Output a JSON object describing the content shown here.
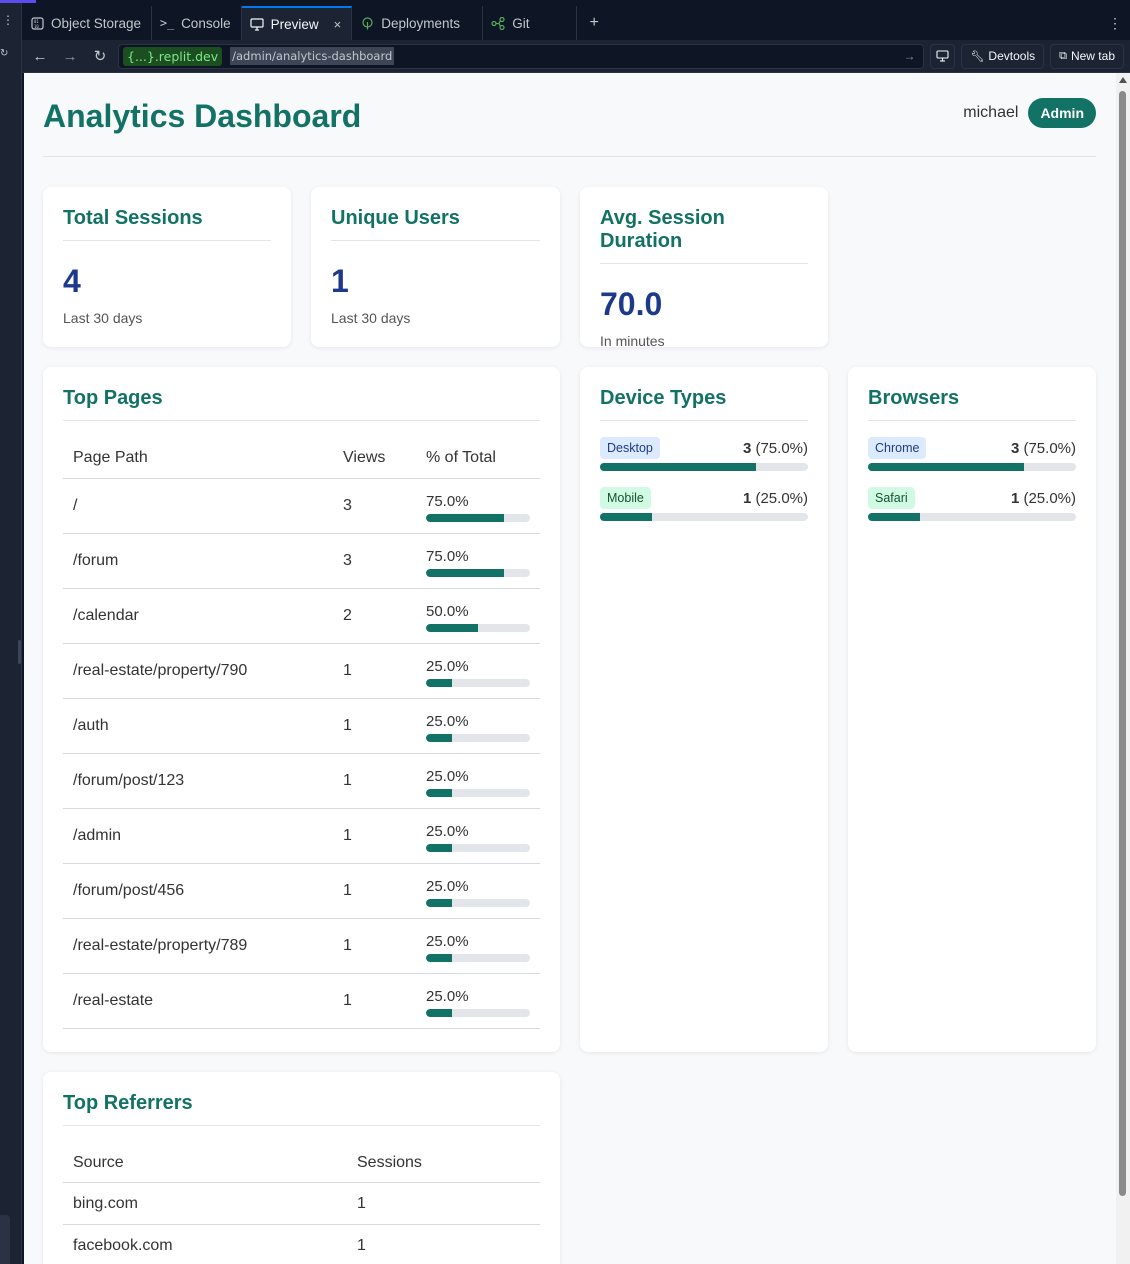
{
  "ide": {
    "tabs": [
      {
        "label": "Object Storage",
        "icon": "storage-icon"
      },
      {
        "label": "Console",
        "icon": "terminal-icon"
      },
      {
        "label": "Preview",
        "icon": "monitor-icon",
        "active": true
      },
      {
        "label": "Deployments",
        "icon": "deploy-icon"
      },
      {
        "label": "Git",
        "icon": "git-icon"
      }
    ],
    "tab_close": "×",
    "tab_add": "+",
    "url": {
      "domain": "{...}.replit.dev",
      "path": "/admin/analytics-dashboard"
    },
    "devtools_label": "Devtools",
    "newtab_label": "New tab"
  },
  "header": {
    "title": "Analytics Dashboard",
    "user": "michael",
    "role": "Admin"
  },
  "stats": [
    {
      "title": "Total Sessions",
      "value": "4",
      "sub": "Last 30 days"
    },
    {
      "title": "Unique Users",
      "value": "1",
      "sub": "Last 30 days"
    },
    {
      "title": "Avg. Session Duration",
      "value": "70.0",
      "sub": "In minutes"
    }
  ],
  "top_pages": {
    "title": "Top Pages",
    "columns": [
      "Page Path",
      "Views",
      "% of Total"
    ],
    "rows": [
      {
        "path": "/",
        "views": "3",
        "pct": "75.0%",
        "fraction": 0.75
      },
      {
        "path": "/forum",
        "views": "3",
        "pct": "75.0%",
        "fraction": 0.75
      },
      {
        "path": "/calendar",
        "views": "2",
        "pct": "50.0%",
        "fraction": 0.5
      },
      {
        "path": "/real-estate/property/790",
        "views": "1",
        "pct": "25.0%",
        "fraction": 0.25
      },
      {
        "path": "/auth",
        "views": "1",
        "pct": "25.0%",
        "fraction": 0.25
      },
      {
        "path": "/forum/post/123",
        "views": "1",
        "pct": "25.0%",
        "fraction": 0.25
      },
      {
        "path": "/admin",
        "views": "1",
        "pct": "25.0%",
        "fraction": 0.25
      },
      {
        "path": "/forum/post/456",
        "views": "1",
        "pct": "25.0%",
        "fraction": 0.25
      },
      {
        "path": "/real-estate/property/789",
        "views": "1",
        "pct": "25.0%",
        "fraction": 0.25
      },
      {
        "path": "/real-estate",
        "views": "1",
        "pct": "25.0%",
        "fraction": 0.25
      }
    ]
  },
  "device_types": {
    "title": "Device Types",
    "items": [
      {
        "label": "Desktop",
        "count": "3",
        "pct": "(75.0%)",
        "fraction": 0.75,
        "chip": "blue"
      },
      {
        "label": "Mobile",
        "count": "1",
        "pct": "(25.0%)",
        "fraction": 0.25,
        "chip": "green"
      }
    ]
  },
  "browsers": {
    "title": "Browsers",
    "items": [
      {
        "label": "Chrome",
        "count": "3",
        "pct": "(75.0%)",
        "fraction": 0.75,
        "chip": "blue"
      },
      {
        "label": "Safari",
        "count": "1",
        "pct": "(25.0%)",
        "fraction": 0.25,
        "chip": "green"
      }
    ]
  },
  "top_referrers": {
    "title": "Top Referrers",
    "columns": [
      "Source",
      "Sessions"
    ],
    "rows": [
      {
        "source": "bing.com",
        "sessions": "1"
      },
      {
        "source": "facebook.com",
        "sessions": "1"
      }
    ]
  },
  "colors": {
    "accent": "#127266",
    "stat_value": "#1d3a8a",
    "ide_bg": "#0e1525"
  }
}
